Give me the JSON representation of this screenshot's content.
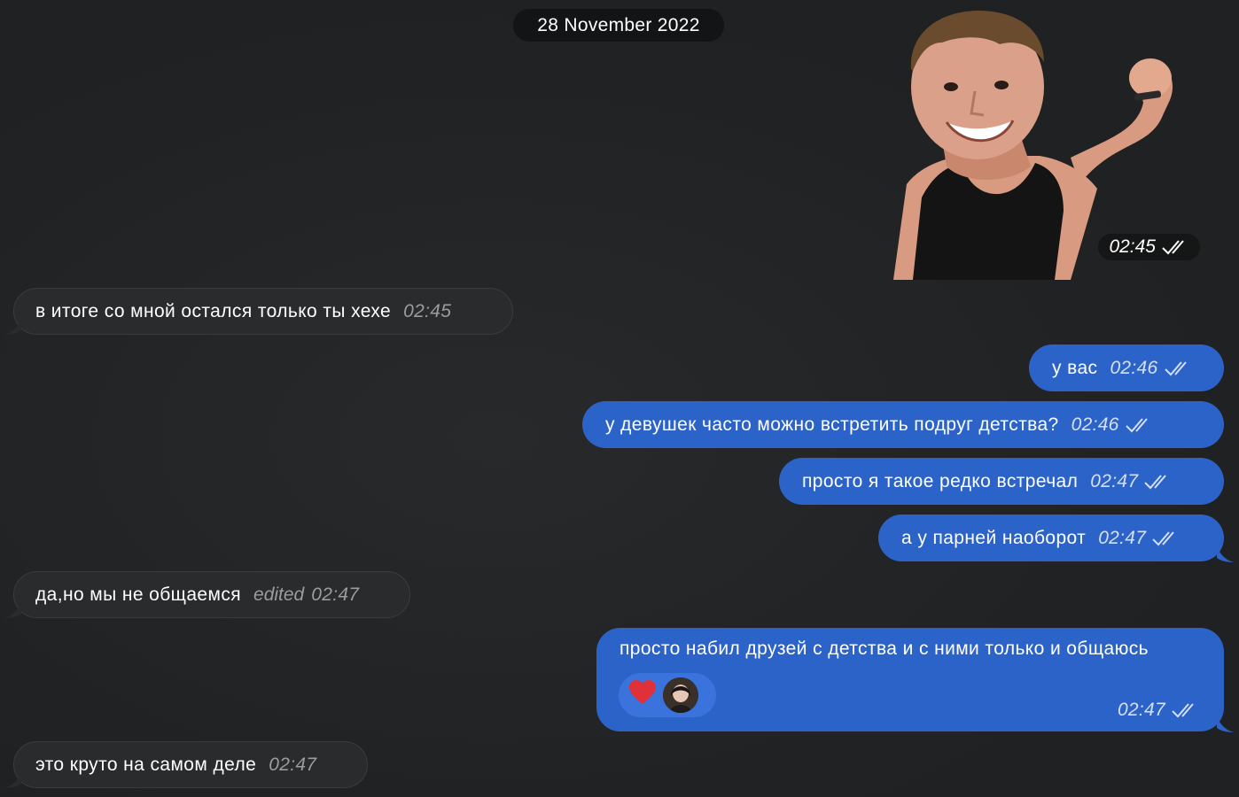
{
  "date_separator": "28 November 2022",
  "sticker": {
    "time": "02:45",
    "status": "read"
  },
  "messages": [
    {
      "direction": "incoming",
      "text": "в итоге со мной остался только ты хехе",
      "time": "02:45"
    },
    {
      "direction": "outgoing",
      "text": "у вас",
      "time": "02:46",
      "status": "read"
    },
    {
      "direction": "outgoing",
      "text": "у девушек часто можно встретить подруг детства?",
      "time": "02:46",
      "status": "read"
    },
    {
      "direction": "outgoing",
      "text": "просто я такое редко встречал",
      "time": "02:47",
      "status": "read"
    },
    {
      "direction": "outgoing",
      "text": "а у парней наоборот",
      "time": "02:47",
      "status": "read"
    },
    {
      "direction": "incoming",
      "text": "да,но мы не общаемся",
      "edited_label": "edited",
      "time": "02:47"
    },
    {
      "direction": "outgoing",
      "text": "просто набил друзей с детства и с ними только и общаюсь",
      "time": "02:47",
      "status": "read",
      "reaction": "heart-icon"
    },
    {
      "direction": "incoming",
      "text": "это круто на самом деле",
      "time": "02:47"
    }
  ],
  "colors": {
    "background": "#212224",
    "incoming_bubble": "#2a2b2d",
    "outgoing_bubble": "#2c63c9",
    "date_pill": "#131415",
    "reaction_heart": "#e0303a"
  }
}
